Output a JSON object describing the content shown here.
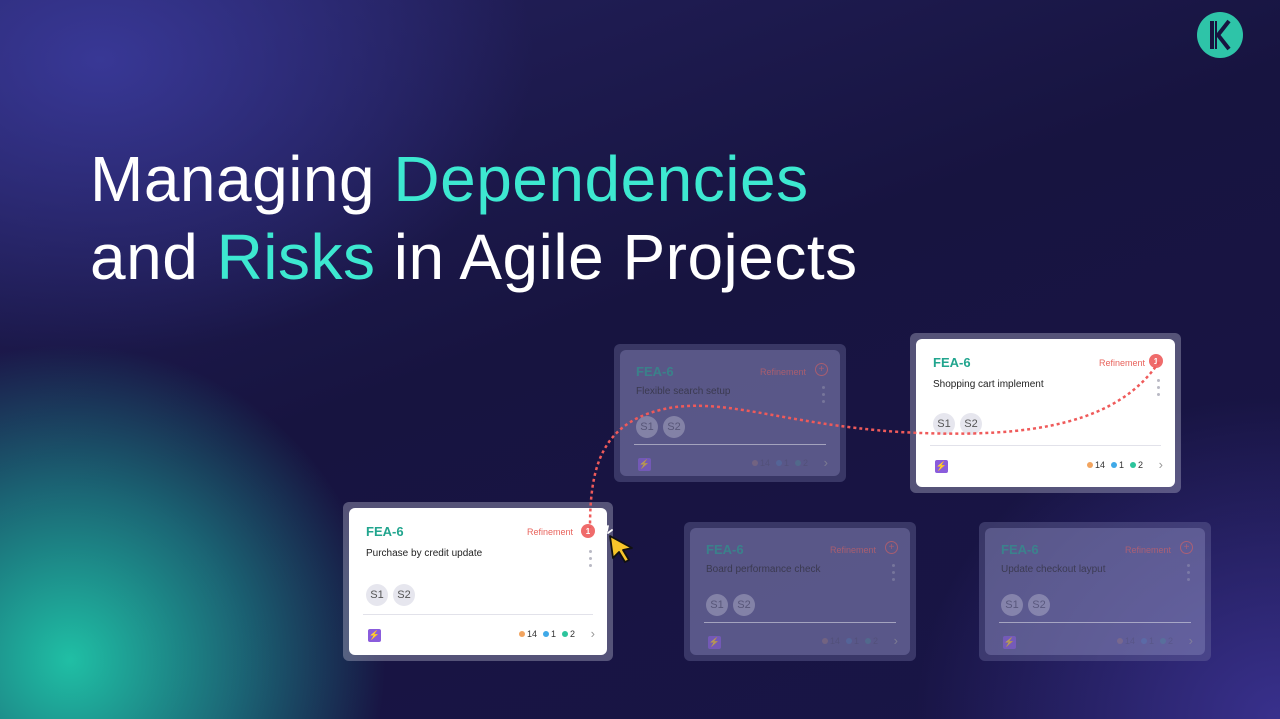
{
  "title": {
    "line1_plain": "Managing ",
    "line1_accent": "Dependencies",
    "line2_plain_a": "and ",
    "line2_accent": "Risks",
    "line2_plain_b": " in Agile Projects"
  },
  "colors": {
    "accent": "#3de8d0",
    "code_green": "#21a58e",
    "status_red": "#e8635c",
    "bolt_purple": "#8a5cdc",
    "dot_orange": "#f2a45f",
    "dot_blue": "#3fa9e8",
    "dot_green": "#2cc49c"
  },
  "cards": [
    {
      "code": "FEA-6",
      "status": "Refinement",
      "badge": "+",
      "title": "Flexible search setup",
      "avatars": [
        "S1",
        "S2"
      ],
      "bolt_icon": "lightning-icon",
      "stats": [
        "14",
        "1",
        "2"
      ]
    },
    {
      "code": "FEA-6",
      "status": "Refinement",
      "badge": "1",
      "title": "Shopping cart implement",
      "avatars": [
        "S1",
        "S2"
      ],
      "bolt_icon": "lightning-icon",
      "stats": [
        "14",
        "1",
        "2"
      ]
    },
    {
      "code": "FEA-6",
      "status": "Refinement",
      "badge": "1",
      "title": "Purchase by credit update",
      "avatars": [
        "S1",
        "S2"
      ],
      "bolt_icon": "lightning-icon",
      "stats": [
        "14",
        "1",
        "2"
      ]
    },
    {
      "code": "FEA-6",
      "status": "Refinement",
      "badge": "+",
      "title": "Board performance check",
      "avatars": [
        "S1",
        "S2"
      ],
      "bolt_icon": "lightning-icon",
      "stats": [
        "14",
        "1",
        "2"
      ]
    },
    {
      "code": "FEA-6",
      "status": "Refinement",
      "badge": "+",
      "title": "Update checkout layput",
      "avatars": [
        "S1",
        "S2"
      ],
      "bolt_icon": "lightning-icon",
      "stats": [
        "14",
        "1",
        "2"
      ]
    }
  ]
}
